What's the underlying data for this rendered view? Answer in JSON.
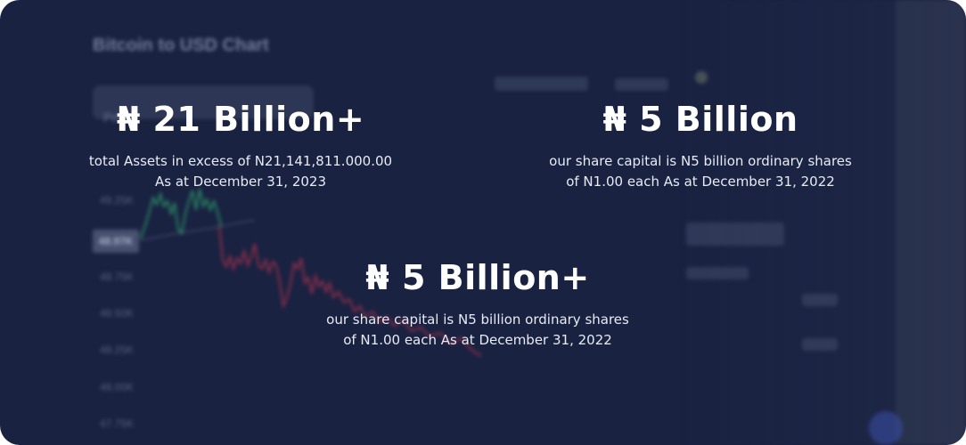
{
  "background": {
    "chart_title": "Bitcoin to USD Chart",
    "price_pill": "Price",
    "current_price": "48.97K",
    "y_ticks": [
      "49.25K",
      "48.75K",
      "48.50K",
      "48.25K",
      "48.00K",
      "47.75K"
    ],
    "colors": {
      "card": "#1a2242",
      "up_line": "#2faa6e",
      "down_line": "#b8344c"
    }
  },
  "stats": [
    {
      "value": "₦ 21 Billion+",
      "desc_line1": "total Assets in excess of N21,141,811.000.00",
      "desc_line2": "As at December 31, 2023"
    },
    {
      "value": "₦ 5 Billion",
      "desc_line1": "our share capital is N5 billion ordinary shares",
      "desc_line2": "of N1.00 each As at December 31, 2022"
    },
    {
      "value": "₦ 5 Billion+",
      "desc_line1": "our share capital is N5 billion ordinary shares",
      "desc_line2": "of N1.00 each As at December 31, 2022"
    }
  ]
}
